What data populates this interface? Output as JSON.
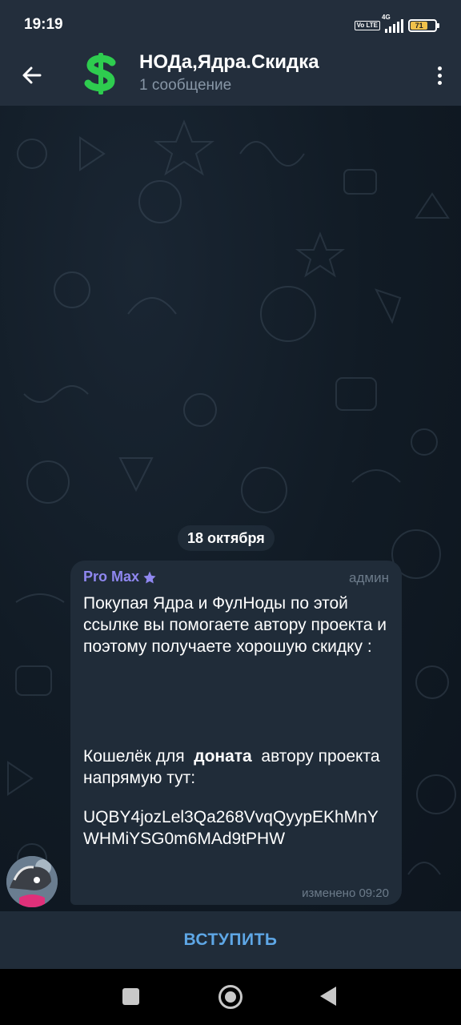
{
  "status_bar": {
    "time": "19:19",
    "network": "4G",
    "volte": "Vo LTE",
    "battery_level": "71"
  },
  "header": {
    "channel_title": "НОДа,Ядра.Скидка",
    "subtitle": "1 сообщение",
    "channel_icon": "dollar-sign",
    "channel_icon_color": "#2ecc4f"
  },
  "chat": {
    "date_label": "18 октября",
    "message": {
      "sender": "Pro Max",
      "sender_color": "#8f87f0",
      "role": "админ",
      "paragraph1": "Покупая Ядра и ФулНоды по этой ссылке вы помогаете автору проекта и поэтому получаете хорошую скидку :",
      "paragraph2_before": "Кошелёк для",
      "paragraph2_bold": "доната",
      "paragraph2_after": "автору проекта  напрямую тут:",
      "wallet": "UQBY4jozLel3Qa268VvqQyypEKhMnYWHMiYSG0m6MAd9tPHW",
      "edited_label": "изменено 09:20"
    }
  },
  "footer": {
    "join_label": "ВСТУПИТЬ",
    "accent_color": "#5ea7e6"
  },
  "nav": {
    "recents": "recents-icon",
    "home": "home-icon",
    "back": "back-icon"
  }
}
